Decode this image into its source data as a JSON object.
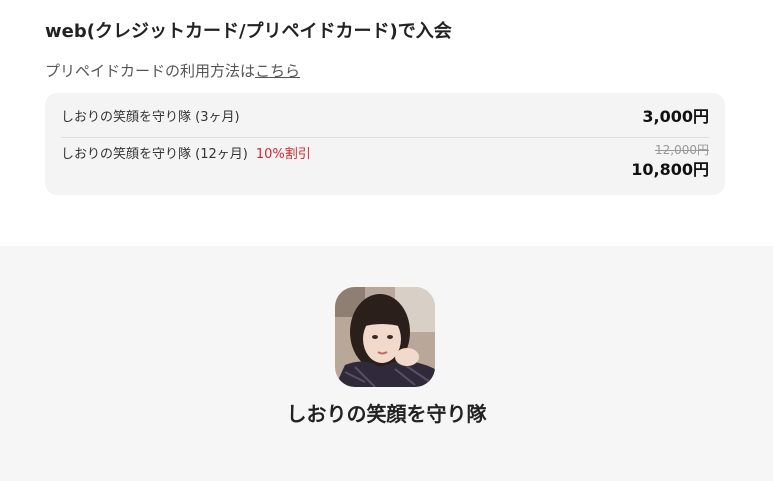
{
  "join_section": {
    "title": "web(クレジットカード/プリペイドカード)で入会",
    "prepaid_note_prefix": "プリペイドカードの利用方法は",
    "prepaid_note_link": "こちら"
  },
  "plans": [
    {
      "name": "しおりの笑顔を守り隊 (3ヶ月)",
      "price": "3,000円"
    },
    {
      "name": "しおりの笑顔を守り隊 (12ヶ月)",
      "discount": "10%割引",
      "original_price": "12,000円",
      "price": "10,800円"
    }
  ],
  "fanclub": {
    "name": "しおりの笑顔を守り隊",
    "avatar_icon": "profile-photo"
  },
  "colors": {
    "discount": "#d7262e",
    "box_background": "#f4f4f4",
    "footer_background": "#f6f6f6"
  }
}
